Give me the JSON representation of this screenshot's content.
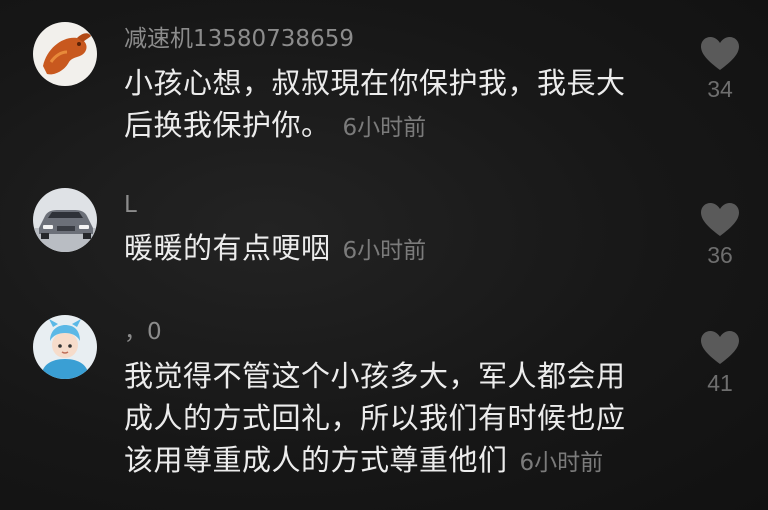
{
  "comments": [
    {
      "username": "减速机13580738659",
      "lines": [
        "小孩心想，叔叔現在你保护我，我長大",
        "后换我保护你。"
      ],
      "timestamp": "6小时前",
      "likes": "34",
      "avatar_icon": "roast-chicken-avatar"
    },
    {
      "username": "L",
      "lines": [
        "暖暖的有点哽咽"
      ],
      "timestamp": "6小时前",
      "likes": "36",
      "avatar_icon": "car-avatar"
    },
    {
      "username": "，0",
      "lines": [
        "我觉得不管这个小孩多大，军人都会用",
        "成人的方式回礼，所以我们有时候也应",
        "该用尊重成人的方式尊重他们"
      ],
      "timestamp": "6小时前",
      "likes": "41",
      "avatar_icon": "cartoon-person-avatar"
    }
  ],
  "colors": {
    "background": "#161616",
    "username": "#8c8c8c",
    "text": "#ececec",
    "heart": "#5a5a5a"
  }
}
